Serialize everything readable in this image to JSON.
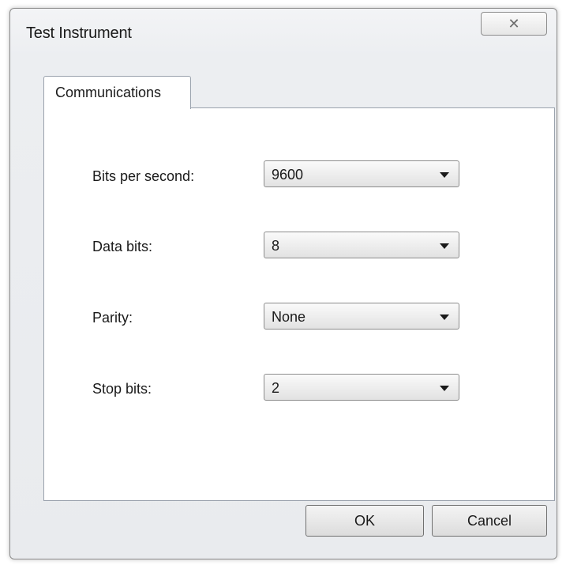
{
  "window": {
    "title": "Test Instrument",
    "close_symbol": "✕"
  },
  "tabs": [
    {
      "label": "Communications",
      "active": true
    }
  ],
  "fields": [
    {
      "label": "Bits per second:",
      "value": "9600"
    },
    {
      "label": "Data bits:",
      "value": "8"
    },
    {
      "label": "Parity:",
      "value": "None"
    },
    {
      "label": "Stop bits:",
      "value": "2"
    }
  ],
  "buttons": {
    "ok_label": "OK",
    "cancel_label": "Cancel"
  }
}
